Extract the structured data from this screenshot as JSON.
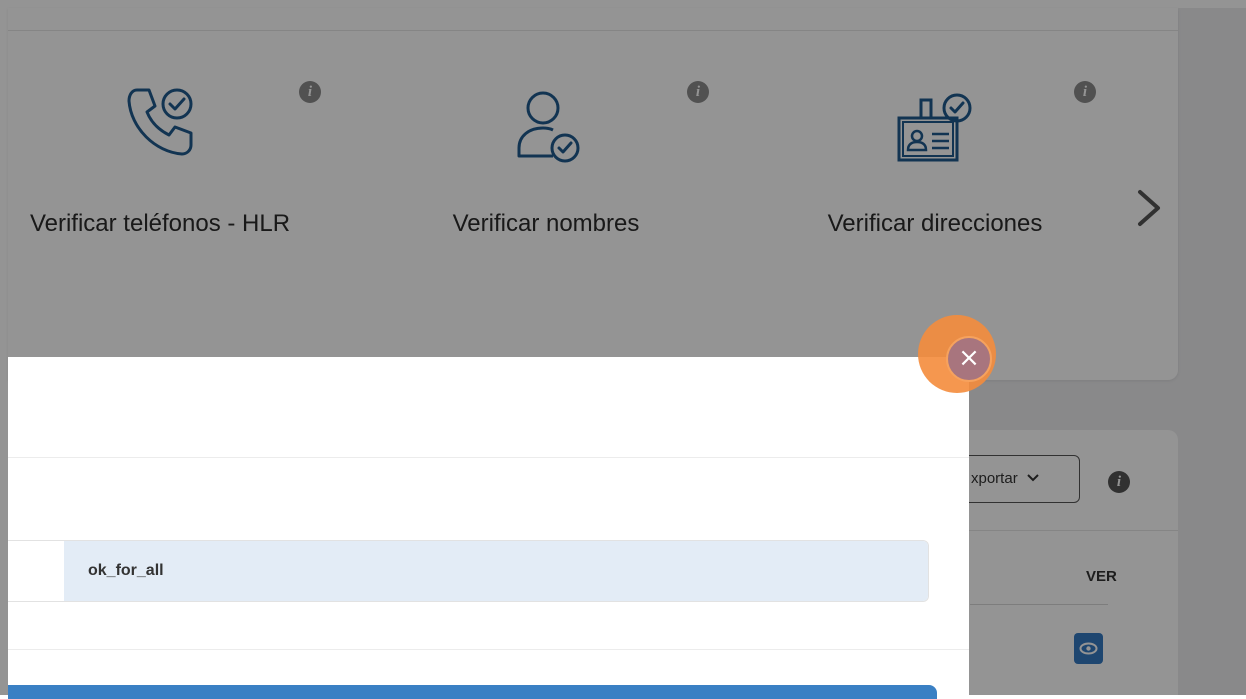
{
  "services": {
    "items": [
      {
        "label": "Verificar teléfonos - HLR",
        "icon": "phone-check-icon"
      },
      {
        "label": "Verificar nombres",
        "icon": "user-check-icon"
      },
      {
        "label": "Verificar direcciones",
        "icon": "id-card-check-icon"
      }
    ],
    "info_glyph": "i",
    "next_icon": "chevron-right-icon"
  },
  "table_panel": {
    "export_label": "xportar",
    "info_glyph": "i",
    "column_header": "VER",
    "view_icon": "eye-icon"
  },
  "modal": {
    "field_value": "ok_for_all",
    "close_glyph": "×"
  },
  "colors": {
    "accent": "#3a80c4",
    "icon_blue": "#1f5a8e",
    "highlight_orange": "#f48c3c",
    "field_bg": "#e3ecf6"
  }
}
